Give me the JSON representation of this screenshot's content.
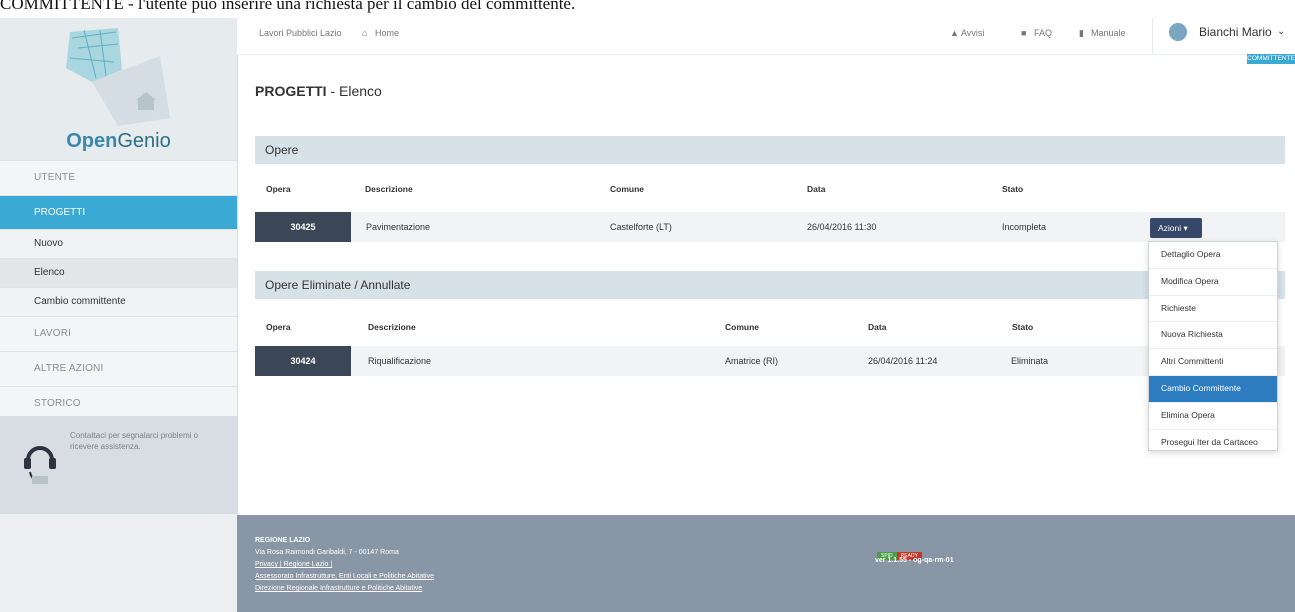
{
  "caption": "COMMITTENTE - l'utente può inserire una richiesta per il cambio del committente.",
  "colors": {
    "accent": "#3aa9d4",
    "dark_row": "#3b4756",
    "button": "#36486a",
    "highlight": "#2e7cc0",
    "footer": "#8996a5",
    "section": "#d7e1e8"
  },
  "sidebar": {
    "logo_bold": "Open",
    "logo_rest": "Genio",
    "items": [
      {
        "label": "UTENTE",
        "type": "top"
      },
      {
        "label": "PROGETTI",
        "type": "active"
      },
      {
        "label": "Nuovo",
        "type": "sub"
      },
      {
        "label": "Elenco",
        "type": "sub-selected"
      },
      {
        "label": "Cambio committente",
        "type": "sub"
      },
      {
        "label": "LAVORI",
        "type": "top"
      },
      {
        "label": "ALTRE AZIONI",
        "type": "top"
      },
      {
        "label": "STORICO",
        "type": "top"
      }
    ],
    "help_text": "Contattaci per segnalarci problemi o ricevere assistenza.",
    "help_icon": "headset-icon"
  },
  "topbar": {
    "breadcrumb_root": "Lavori Pubblici Lazio",
    "home": "Home",
    "avvisi": "Avvisi",
    "faq": "FAQ",
    "manuale": "Manuale",
    "user": "Bianchi Mario",
    "role_badge": "COMMITTENTE"
  },
  "page": {
    "title_bold": "PROGETTI",
    "title_rest": " - Elenco"
  },
  "opere": {
    "section_title": "Opere",
    "headers": [
      "Opera",
      "Descrizione",
      "Comune",
      "Data",
      "Stato"
    ],
    "rows": [
      {
        "id": "30425",
        "descrizione": "Pavimentazione",
        "comune": "Castelforte (LT)",
        "data": "26/04/2016 11:30",
        "stato": "Incompleta"
      }
    ],
    "actions_label": "Azioni ▾"
  },
  "eliminate": {
    "section_title": "Opere Eliminate / Annullate",
    "headers": [
      "Opera",
      "Descrizione",
      "Comune",
      "Data",
      "Stato"
    ],
    "rows": [
      {
        "id": "30424",
        "descrizione": "Riqualificazione",
        "comune": "Amatrice (RI)",
        "data": "26/04/2016 11:24",
        "stato": "Eliminata"
      }
    ]
  },
  "dropdown": {
    "items": [
      "Dettaglio Opera",
      "Modifica Opera",
      "Richieste",
      "Nuova Richiesta",
      "Altri Committenti",
      "Cambio Committente",
      "Elimina Opera",
      "Prosegui Iter da Cartaceo"
    ],
    "highlighted": "Cambio Committente"
  },
  "footer": {
    "org": "REGIONE LAZIO",
    "address": "Via Rosa Raimondi Garibaldi, 7 - 00147 Roma",
    "links1": "Privacy | Regione Lazio |",
    "link2": "Assessorato Infrastrutture, Enti Locali e Politiche Abitative",
    "link3": "Direzione Regionale Infrastrutture e Politiche Abitative",
    "tag1": "SPID",
    "tag2": "READY",
    "version": "ver 1.1.55 - og-qa-rm-01"
  }
}
